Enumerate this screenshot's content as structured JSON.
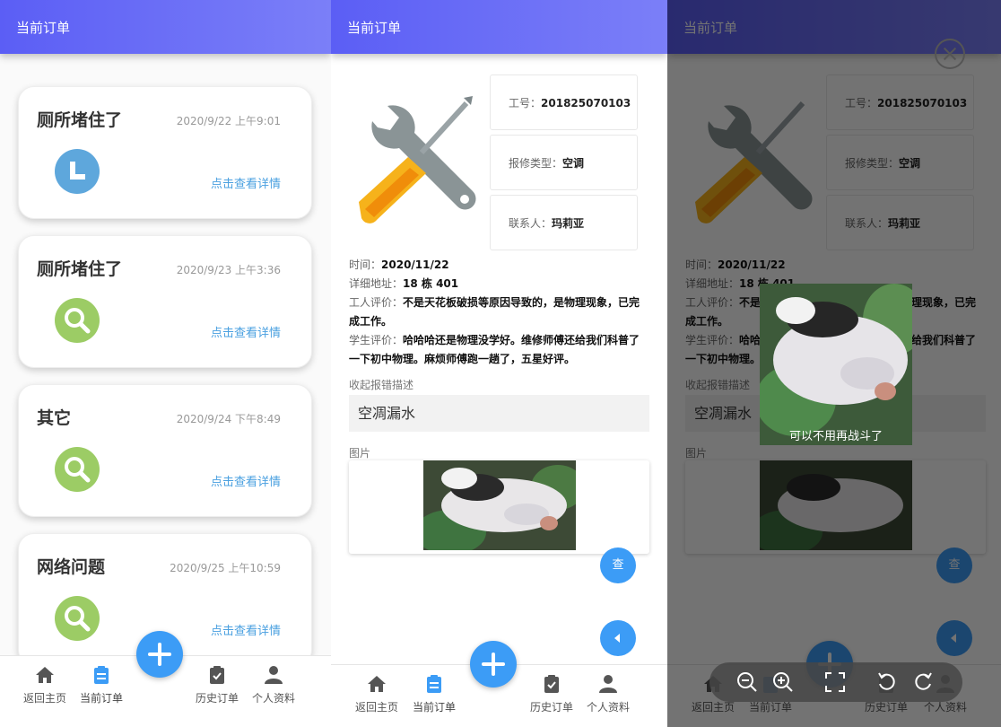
{
  "panel1": {
    "header_title": "当前订单",
    "orders": [
      {
        "title": "厕所堵住了",
        "date": "2020/9/22 上午9:01",
        "link": "点击查看详情",
        "icon": "clock-icon",
        "color": "#5ea7dc"
      },
      {
        "title": "厕所堵住了",
        "date": "2020/9/23 上午3:36",
        "link": "点击查看详情",
        "icon": "search-icon",
        "color": "#9ccc65"
      },
      {
        "title": "其它",
        "date": "2020/9/24 下午8:49",
        "link": "点击查看详情",
        "icon": "search-icon",
        "color": "#9ccc65"
      },
      {
        "title": "网络问题",
        "date": "2020/9/25 上午10:59",
        "link": "点击查看详情",
        "icon": "search-icon",
        "color": "#9ccc65"
      }
    ]
  },
  "tabs": {
    "home": "返回主页",
    "current": "当前订单",
    "history": "历史订单",
    "profile": "个人资料"
  },
  "detail": {
    "header_title": "当前订单",
    "worker_id_label": "工号：",
    "worker_id": "201825070103",
    "repair_type_label": "报修类型：",
    "repair_type": "空调",
    "contact_label": "联系人：",
    "contact": "玛莉亚",
    "time_label": "时间：",
    "time": "2020/11/22",
    "address_label": "详细地址：",
    "address": "18 栋 401",
    "worker_eval_label": "工人评价：",
    "worker_eval": "不是天花板破损等原因导致的，是物理现象，已完成工作。",
    "student_eval_label": "学生评价：",
    "student_eval": "哈哈哈还是物理没学好。维修师傅还给我们科普了一下初中物理。麻烦师傅跑一趟了，五星好评。",
    "collapse_label": "收起报错描述",
    "description": "空凋漏水",
    "image_label": "图片",
    "view_button": "查"
  },
  "viewer": {
    "caption": "可以不用再战斗了",
    "tools": [
      "zoom-out-icon",
      "zoom-in-icon",
      "fullscreen-icon",
      "rotate-left-icon",
      "rotate-right-icon"
    ]
  },
  "colors": {
    "header_start": "#5b5ef5",
    "header_end": "#7b7ff8",
    "accent": "#3c9cf6",
    "link": "#4aa0e0"
  }
}
